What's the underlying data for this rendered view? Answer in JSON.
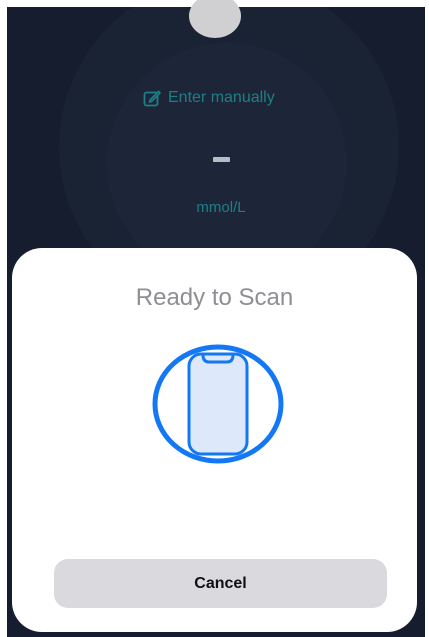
{
  "manual_entry": {
    "label": "Enter manually",
    "icon": "edit-icon"
  },
  "reading": {
    "value": "–",
    "unit": "mmol/L"
  },
  "scan_sheet": {
    "title": "Ready to Scan",
    "icon": "phone-scan-icon",
    "cancel_label": "Cancel"
  },
  "colors": {
    "background": "#151d2e",
    "accent": "#1f7f86",
    "scan_blue": "#1478f5",
    "button": "#d9d9de"
  }
}
